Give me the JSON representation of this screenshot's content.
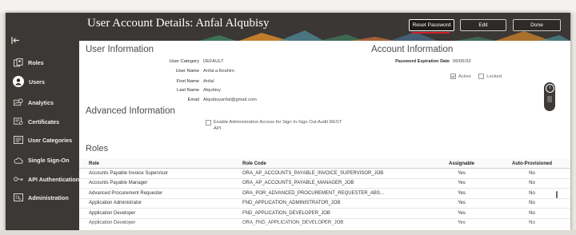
{
  "header": {
    "title": "User Account Details: Anfal Alqubisy",
    "reset_password": "Reset Password",
    "edit": "Edit",
    "done": "Done"
  },
  "sidebar": {
    "collapse_icon": "collapse-sidebar-icon",
    "items": [
      {
        "label": "Roles",
        "icon": "roles-icon"
      },
      {
        "label": "Users",
        "icon": "user-icon",
        "active": true
      },
      {
        "label": "Analytics",
        "icon": "analytics-icon"
      },
      {
        "label": "Certificates",
        "icon": "certificate-icon"
      },
      {
        "label": "User Categories",
        "icon": "user-categories-icon"
      },
      {
        "label": "Single Sign-On",
        "icon": "cloud-icon"
      },
      {
        "label": "API Authentication",
        "icon": "key-icon"
      },
      {
        "label": "Administration",
        "icon": "administration-icon"
      }
    ]
  },
  "user_info": {
    "title": "User Information",
    "category_label": "User Category",
    "category_value": "DEFAULT",
    "username_label": "User Name",
    "username_value": "Anfal.a.Ibrahim",
    "firstname_label": "First Name",
    "firstname_value": "Anfal",
    "lastname_label": "Last Name",
    "lastname_value": "Alqubisy",
    "email_label": "Email",
    "email_value": "Alqubisyanfal@gmail.com"
  },
  "account_info": {
    "title": "Account Information",
    "expiration_label": "Password Expiration Date",
    "expiration_value": "06/06/33",
    "active_label": "Active",
    "locked_label": "Locked",
    "active": true,
    "locked": false
  },
  "advanced_info": {
    "title": "Advanced Information",
    "checkbox_label_line1": "Enable Administration Access for Sign In-Sign Out Audit REST",
    "checkbox_label_line2": "API"
  },
  "roles": {
    "title": "Roles",
    "columns": [
      "Role",
      "Role Code",
      "Assignable",
      "Auto-Provisioned"
    ],
    "rows": [
      [
        "Accounts Payable Invoice Supervisor",
        "ORA_AP_ACCOUNTS_PAYABLE_INVOICE_SUPERVISOR_JOB",
        "Yes",
        "No"
      ],
      [
        "Accounts Payable Manager",
        "ORA_AP_ACCOUNTS_PAYABLE_MANAGER_JOB",
        "Yes",
        "No"
      ],
      [
        "Advanced Procurement Requester",
        "ORA_POR_ADVANCED_PROCUREMENT_REQUESTER_ABS...",
        "Yes",
        "No"
      ],
      [
        "Application Administrator",
        "FND_APPLICATION_ADMINISTRATOR_JOB",
        "Yes",
        "No"
      ],
      [
        "Application Developer",
        "FND_APPLICATION_DEVELOPER_JOB",
        "Yes",
        "No"
      ],
      [
        "Application Developer",
        "ORA_FND_APPLICATION_DEVELOPER_JOB",
        "Yes",
        "No"
      ]
    ]
  },
  "colors": {
    "sidebar_bg": "#3b3836",
    "header_bg": "#3a3734",
    "accent_underline": "#d4202a",
    "pattern_green": "#3f7d5e",
    "pattern_orange": "#d98a2b"
  }
}
